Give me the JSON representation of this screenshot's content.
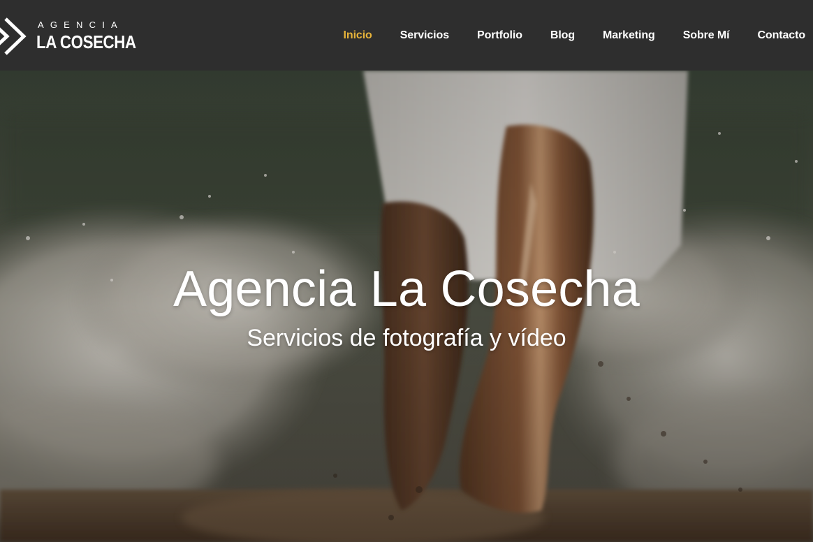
{
  "header": {
    "logo": {
      "top_text": "AGENCIA",
      "bottom_text": "LA COSECHA",
      "icon": "double-chevron-logo-icon"
    },
    "nav": [
      {
        "label": "Inicio",
        "active": true
      },
      {
        "label": "Servicios",
        "active": false
      },
      {
        "label": "Portfolio",
        "active": false
      },
      {
        "label": "Blog",
        "active": false
      },
      {
        "label": "Marketing",
        "active": false
      },
      {
        "label": "Sobre Mí",
        "active": false
      },
      {
        "label": "Contacto",
        "active": false
      }
    ]
  },
  "hero": {
    "title": "Agencia La Cosecha",
    "subtitle": "Servicios de fotografía y vídeo",
    "background": "photo-feet-running-through-surf-at-night"
  },
  "colors": {
    "header_bg": "#2e2e2e",
    "nav_text": "#ffffff",
    "nav_active": "#e8b43a",
    "hero_text": "#ffffff"
  }
}
